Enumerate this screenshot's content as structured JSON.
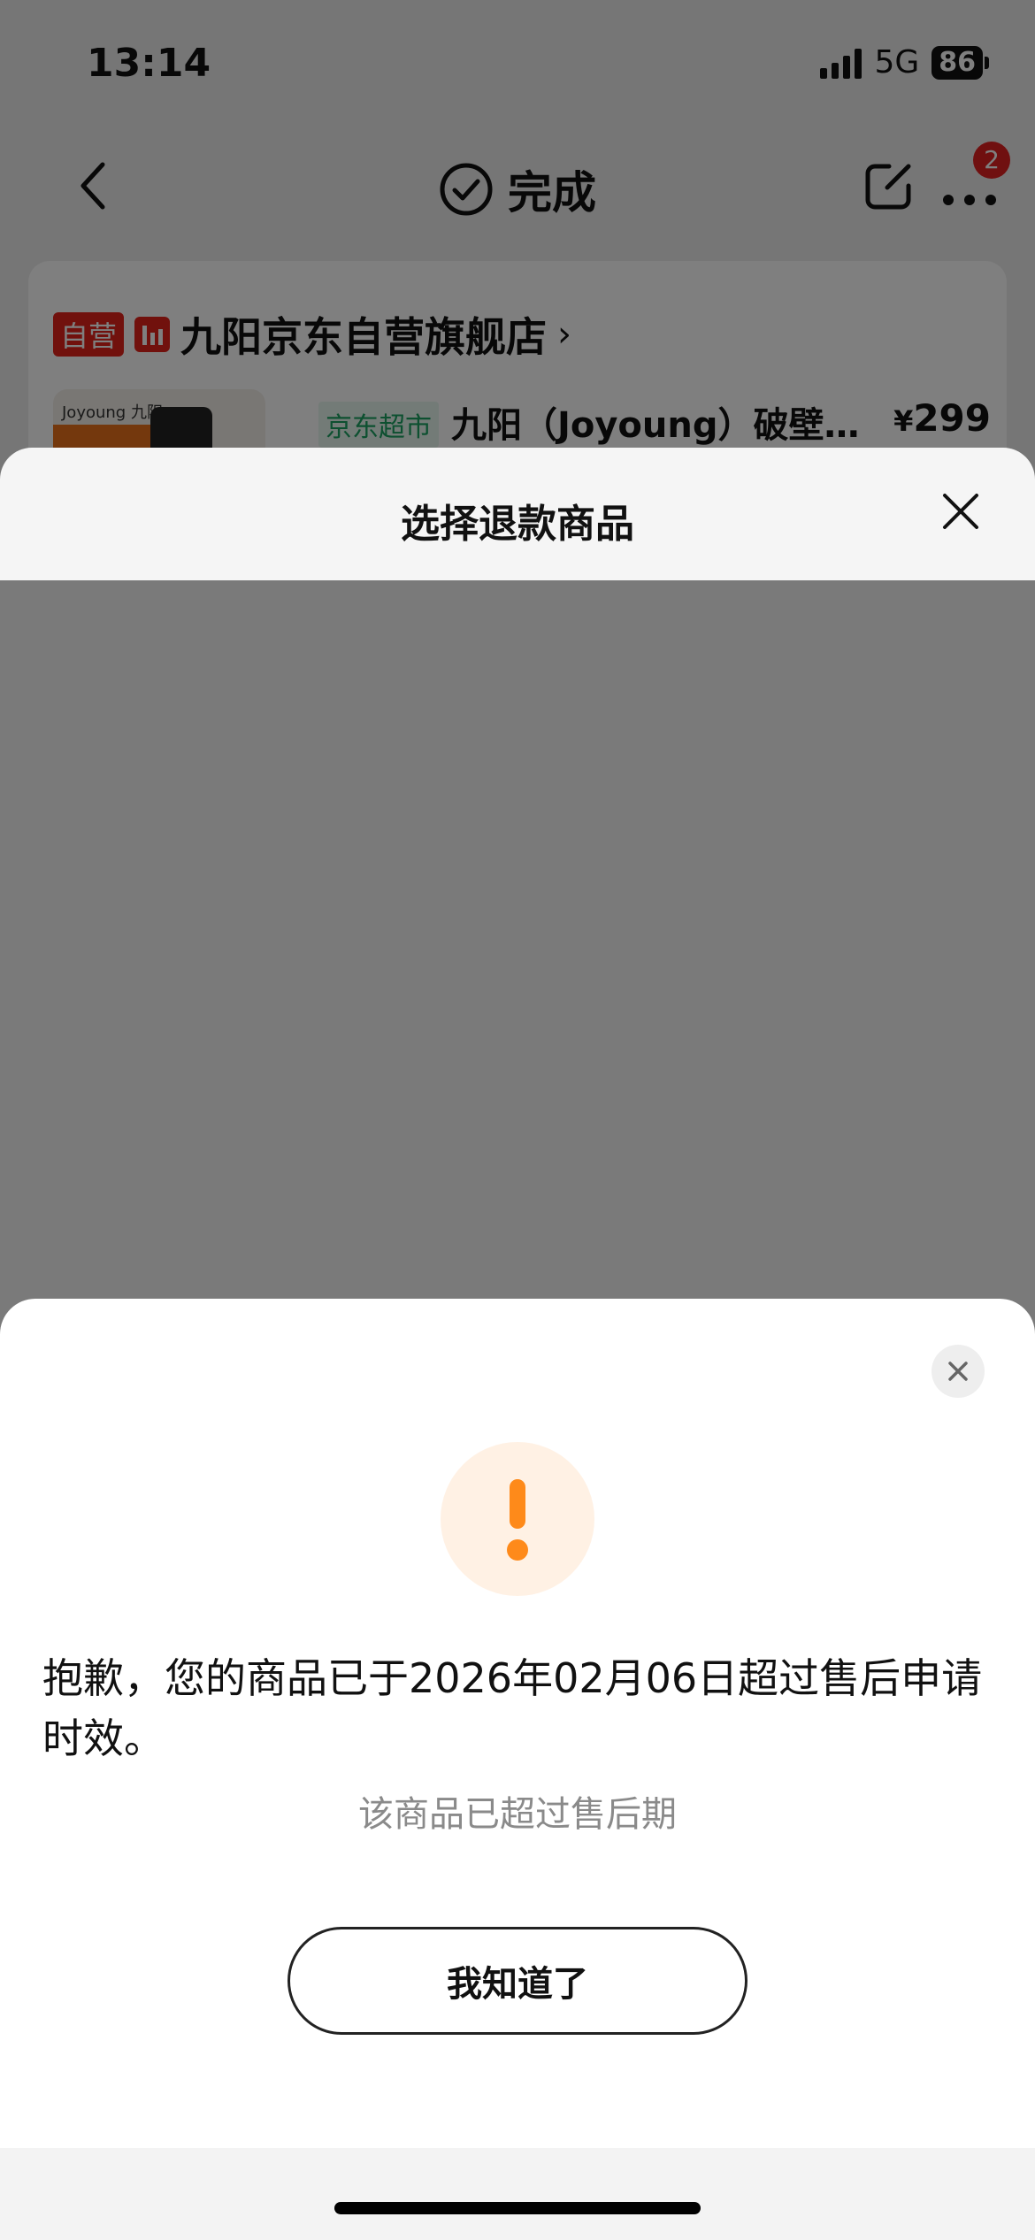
{
  "status_bar": {
    "time": "13:14",
    "network": "5G",
    "battery": "86"
  },
  "nav": {
    "title": "完成",
    "badge_count": "2",
    "icons": [
      "back-icon",
      "check-circle-icon",
      "share-icon",
      "more-icon"
    ]
  },
  "shop": {
    "self_operated_tag": "自营",
    "name": "九阳京东自营旗舰店",
    "chevron": "›",
    "product": {
      "thumb_brand": "Joyoung 九阳",
      "channel_tag": "京东超市",
      "title": "九阳（Joyoung）破壁…",
      "price_symbol": "¥",
      "price": "299"
    }
  },
  "refund_sheet": {
    "title": "选择退款商品"
  },
  "alert": {
    "message": "抱歉，您的商品已于2026年02月06日超过售后申请时效。",
    "sub": "该商品已超过售后期",
    "button": "我知道了",
    "accent_color": "#fe8a1a"
  }
}
